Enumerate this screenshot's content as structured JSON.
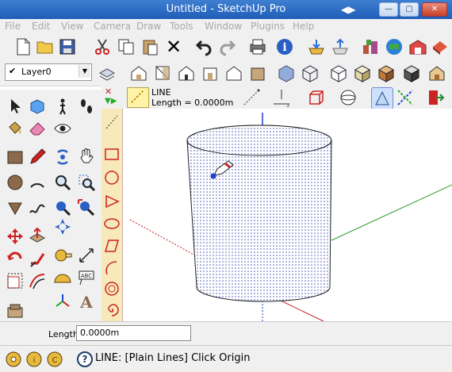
{
  "window": {
    "title": "Untitled - SketchUp Pro"
  },
  "menus": [
    "File",
    "Edit",
    "View",
    "Camera",
    "Draw",
    "Tools",
    "Window",
    "Plugins",
    "Help"
  ],
  "layer": {
    "value": "Layer0"
  },
  "line_tool": {
    "name": "LINE",
    "length_readout": "Length = 0.0000m"
  },
  "vcb": {
    "label": "Length",
    "value": "0.0000m"
  },
  "status": {
    "text": "LINE: [Plain Lines] Click Origin"
  },
  "colors": {
    "title_bar": "#2a66c2",
    "draw_palette": "#f7e9b9",
    "red_axis": "#c0201c",
    "green_axis": "#2e9b2e",
    "blue_axis": "#1d3dd6"
  }
}
